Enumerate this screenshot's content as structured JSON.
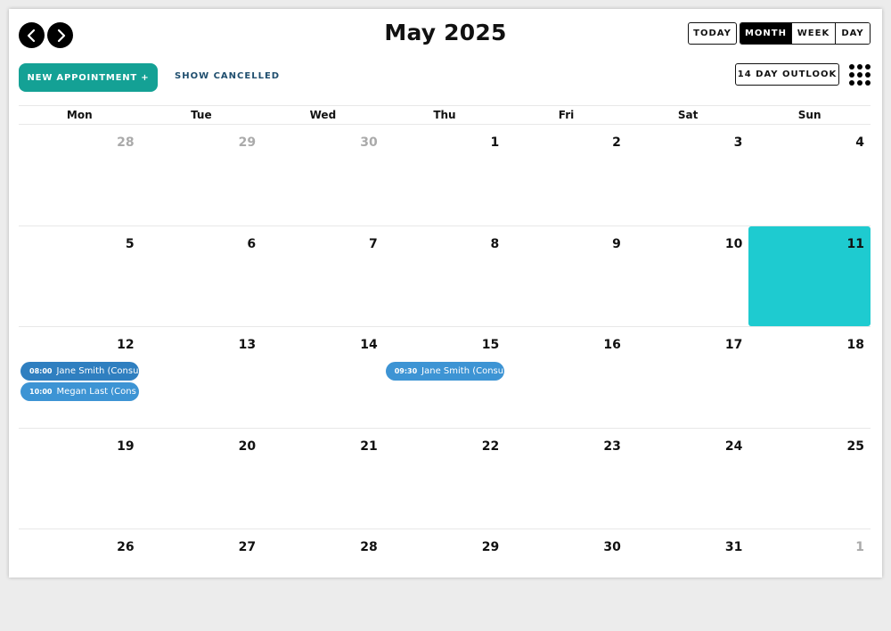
{
  "header": {
    "title": "May 2025",
    "today_label": "TODAY",
    "views": [
      {
        "label": "MONTH",
        "active": true
      },
      {
        "label": "WEEK",
        "active": false
      },
      {
        "label": "DAY",
        "active": false
      }
    ],
    "new_appointment_label": "NEW APPOINTMENT +",
    "show_cancelled_label": "SHOW CANCELLED",
    "outlook_label": "14 DAY OUTLOOK"
  },
  "colors": {
    "accent": "#14a195",
    "today_highlight": "#1ecbd0",
    "event": "#3d94d4"
  },
  "weekdays": [
    "Mon",
    "Tue",
    "Wed",
    "Thu",
    "Fri",
    "Sat",
    "Sun"
  ],
  "weeks": [
    {
      "days": [
        "28",
        "29",
        "30",
        "1",
        "2",
        "3",
        "4"
      ]
    },
    {
      "days": [
        "5",
        "6",
        "7",
        "8",
        "9",
        "10",
        "11"
      ]
    },
    {
      "days": [
        "12",
        "13",
        "14",
        "15",
        "16",
        "17",
        "18"
      ]
    },
    {
      "days": [
        "19",
        "20",
        "21",
        "22",
        "23",
        "24",
        "25"
      ]
    },
    {
      "days": [
        "26",
        "27",
        "28",
        "29",
        "30",
        "31",
        "1"
      ]
    }
  ],
  "events": [
    {
      "time": "08:00",
      "title": "Jane Smith (Consu"
    },
    {
      "time": "10:00",
      "title": "Megan Last (Cons"
    },
    {
      "time": "09:30",
      "title": "Jane Smith (Consu"
    }
  ]
}
